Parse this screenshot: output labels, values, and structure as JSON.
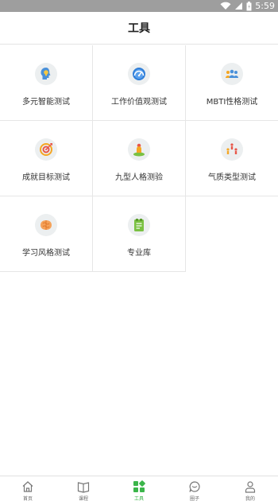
{
  "status_bar": {
    "time": "5:59"
  },
  "header": {
    "title": "工具"
  },
  "tools": [
    {
      "label": "多元智能测试",
      "icon": "brain-bulb-icon"
    },
    {
      "label": "工作价值观测试",
      "icon": "gauge-icon"
    },
    {
      "label": "MBTI性格测试",
      "icon": "people-group-icon"
    },
    {
      "label": "成就目标测试",
      "icon": "target-icon"
    },
    {
      "label": "九型人格测验",
      "icon": "person-pin-icon"
    },
    {
      "label": "气质类型测试",
      "icon": "figures-icon"
    },
    {
      "label": "学习风格测试",
      "icon": "brain-icon"
    },
    {
      "label": "专业库",
      "icon": "document-icon"
    }
  ],
  "tabbar": {
    "items": [
      {
        "label": "首页",
        "icon": "home-icon",
        "active": false
      },
      {
        "label": "课程",
        "icon": "book-icon",
        "active": false
      },
      {
        "label": "工具",
        "icon": "grid-icon",
        "active": true
      },
      {
        "label": "圈子",
        "icon": "chat-icon",
        "active": false
      },
      {
        "label": "我的",
        "icon": "user-icon",
        "active": false
      }
    ]
  },
  "colors": {
    "accent": "#3bb54a",
    "status_bar": "#9e9e9e"
  }
}
